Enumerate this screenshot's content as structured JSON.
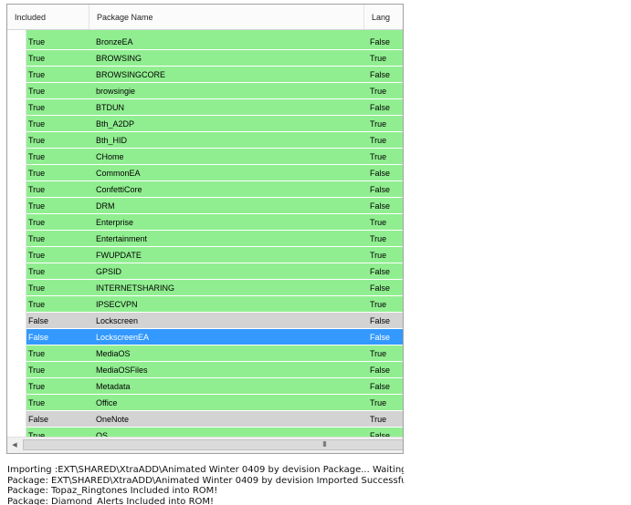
{
  "columns": {
    "included": "Included",
    "name": "Package Name",
    "lang": "Lang"
  },
  "rows": [
    {
      "included": "True",
      "name": "BronzeEA",
      "lang": "False",
      "state": "on"
    },
    {
      "included": "True",
      "name": "BROWSING",
      "lang": "True",
      "state": "on"
    },
    {
      "included": "True",
      "name": "BROWSINGCORE",
      "lang": "False",
      "state": "on"
    },
    {
      "included": "True",
      "name": "browsingie",
      "lang": "True",
      "state": "on"
    },
    {
      "included": "True",
      "name": "BTDUN",
      "lang": "False",
      "state": "on"
    },
    {
      "included": "True",
      "name": "Bth_A2DP",
      "lang": "True",
      "state": "on"
    },
    {
      "included": "True",
      "name": "Bth_HID",
      "lang": "True",
      "state": "on"
    },
    {
      "included": "True",
      "name": "CHome",
      "lang": "True",
      "state": "on"
    },
    {
      "included": "True",
      "name": "CommonEA",
      "lang": "False",
      "state": "on"
    },
    {
      "included": "True",
      "name": "ConfettiCore",
      "lang": "False",
      "state": "on"
    },
    {
      "included": "True",
      "name": "DRM",
      "lang": "False",
      "state": "on"
    },
    {
      "included": "True",
      "name": "Enterprise",
      "lang": "True",
      "state": "on"
    },
    {
      "included": "True",
      "name": "Entertainment",
      "lang": "True",
      "state": "on"
    },
    {
      "included": "True",
      "name": "FWUPDATE",
      "lang": "True",
      "state": "on"
    },
    {
      "included": "True",
      "name": "GPSID",
      "lang": "False",
      "state": "on"
    },
    {
      "included": "True",
      "name": "INTERNETSHARING",
      "lang": "False",
      "state": "on"
    },
    {
      "included": "True",
      "name": "IPSECVPN",
      "lang": "True",
      "state": "on"
    },
    {
      "included": "False",
      "name": "Lockscreen",
      "lang": "False",
      "state": "off"
    },
    {
      "included": "False",
      "name": "LockscreenEA",
      "lang": "False",
      "state": "sel"
    },
    {
      "included": "True",
      "name": "MediaOS",
      "lang": "True",
      "state": "on"
    },
    {
      "included": "True",
      "name": "MediaOSFiles",
      "lang": "False",
      "state": "on"
    },
    {
      "included": "True",
      "name": "Metadata",
      "lang": "False",
      "state": "on"
    },
    {
      "included": "True",
      "name": "Office",
      "lang": "True",
      "state": "on"
    },
    {
      "included": "False",
      "name": "OneNote",
      "lang": "True",
      "state": "off"
    },
    {
      "included": "True",
      "name": "OS",
      "lang": "False",
      "state": "on"
    }
  ],
  "scrollbar": {
    "grip": "III",
    "left_arrow": "◀"
  },
  "log": [
    "Importing :EXT\\SHARED\\XtraADD\\Animated Winter 0409 by devision Package... Waiting.",
    "Package: EXT\\SHARED\\XtraADD\\Animated Winter 0409 by devision Imported Successfully",
    "Package: Topaz_Ringtones Included into ROM!",
    "Package: Diamond_Alerts Included into ROM!"
  ]
}
